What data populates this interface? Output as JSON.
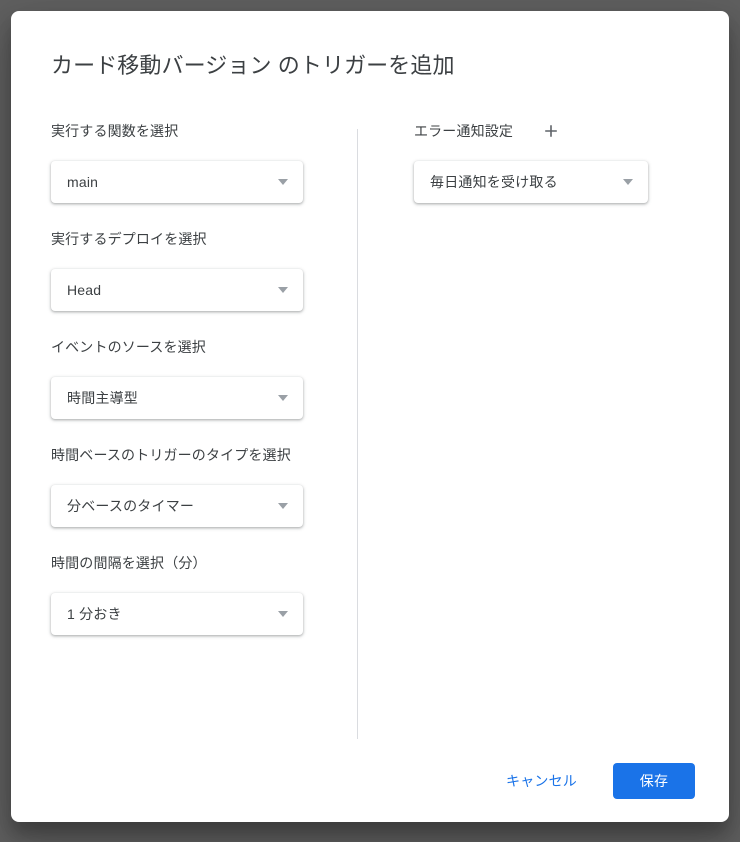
{
  "backdrop_color": "#5f5f5f",
  "dialog": {
    "title": "カード移動バージョン のトリガーを追加",
    "left_column": {
      "fields": [
        {
          "label": "実行する関数を選択",
          "value": "main",
          "name": "function-select"
        },
        {
          "label": "実行するデプロイを選択",
          "value": "Head",
          "name": "deployment-select"
        },
        {
          "label": "イベントのソースを選択",
          "value": "時間主導型",
          "name": "event-source-select"
        },
        {
          "label": "時間ベースのトリガーのタイプを選択",
          "value": "分ベースのタイマー",
          "name": "time-trigger-type-select"
        },
        {
          "label": "時間の間隔を選択（分）",
          "value": "1 分おき",
          "name": "interval-select"
        }
      ]
    },
    "right_column": {
      "fields": [
        {
          "label": "エラー通知設定",
          "value": "毎日通知を受け取る",
          "name": "failure-notification-select",
          "add_icon": "plus-icon"
        }
      ]
    },
    "footer": {
      "cancel_label": "キャンセル",
      "save_label": "保存",
      "accent_color": "#1a73e8"
    }
  },
  "icons": {
    "dropdown_arrow": "chevron-down-icon",
    "add": "plus-icon"
  }
}
